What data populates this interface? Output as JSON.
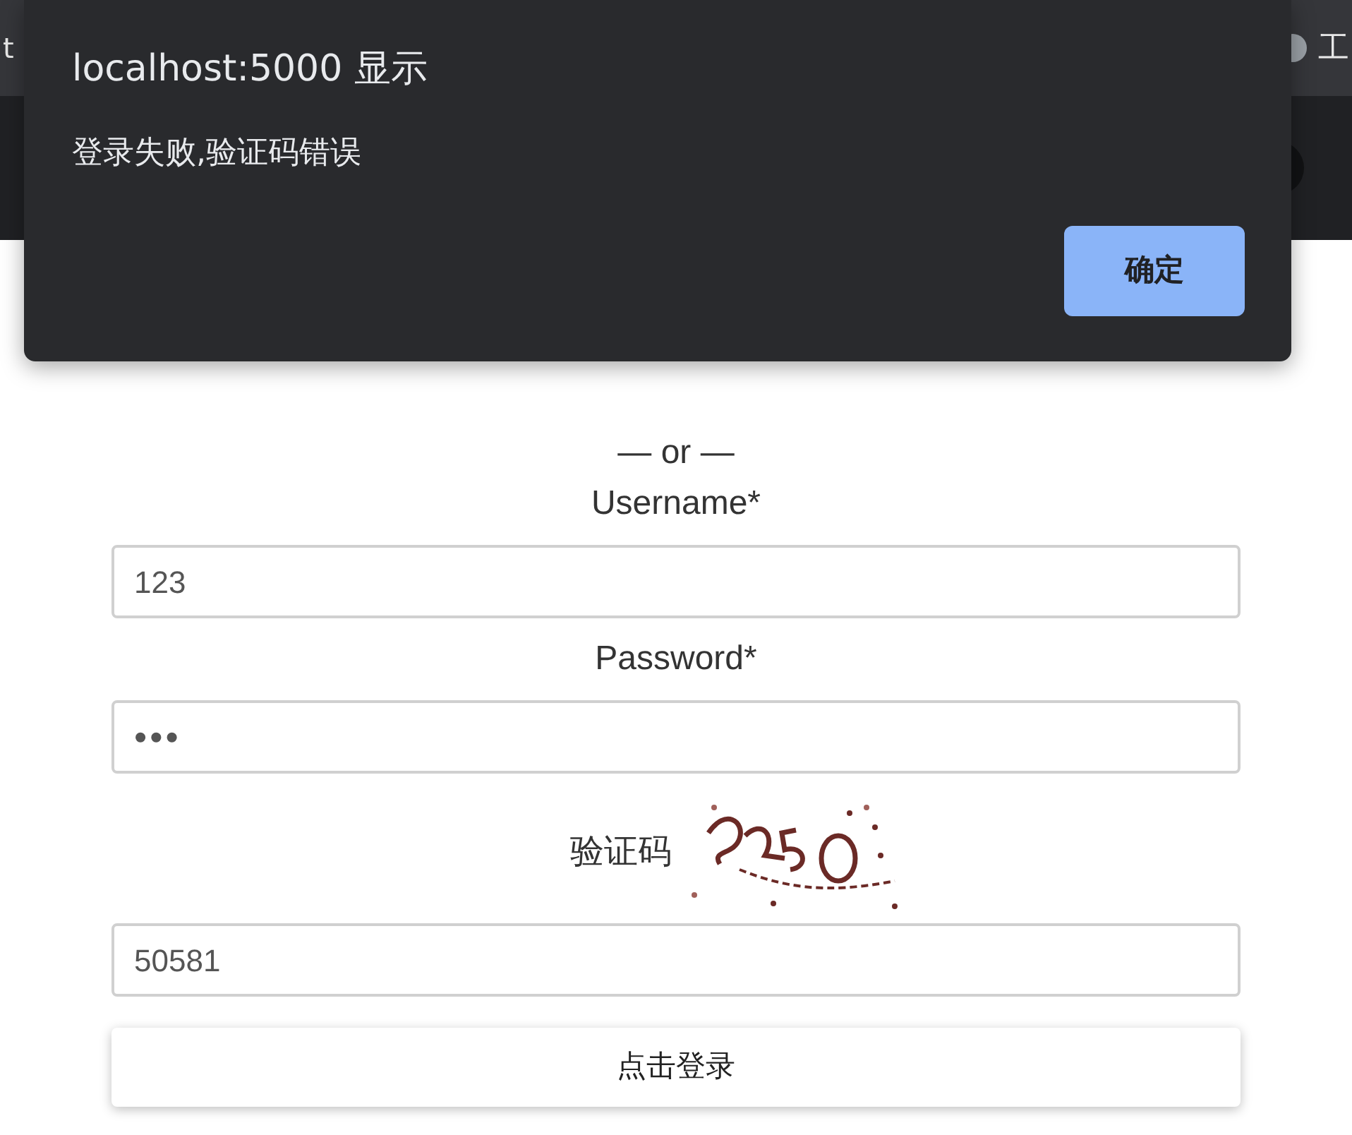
{
  "browser": {
    "tab_left_text": "t",
    "tab_right_text": "工"
  },
  "dialog": {
    "title": "localhost:5000 显示",
    "message": "登录失败,验证码错误",
    "button": "确定"
  },
  "page": {
    "separator": "— or —",
    "fields": [
      {
        "label": "Username*",
        "value": "123",
        "kind": "text"
      },
      {
        "label": "Password*",
        "value": "•••",
        "kind": "password"
      },
      {
        "label": "验证码",
        "value": "50581",
        "kind": "captcha"
      }
    ],
    "submit": "点击登录"
  }
}
